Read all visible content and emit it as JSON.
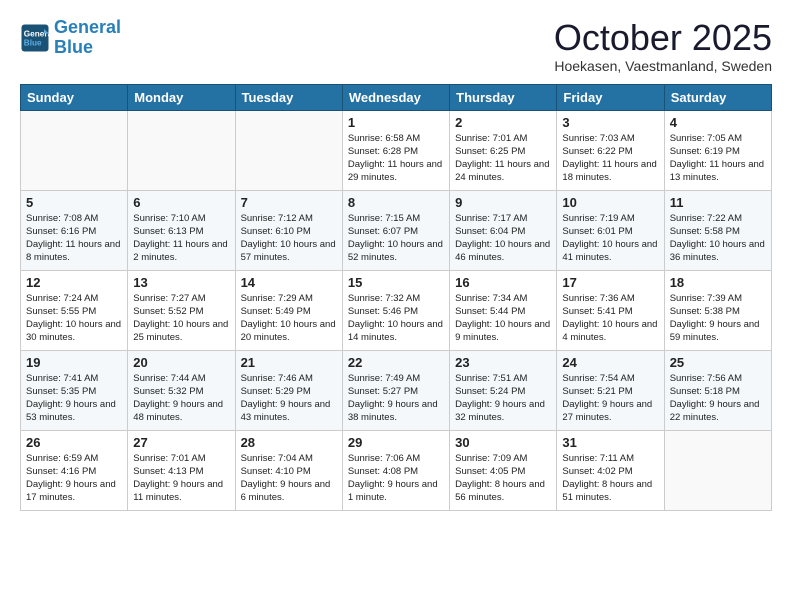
{
  "header": {
    "logo_line1": "General",
    "logo_line2": "Blue",
    "month": "October 2025",
    "location": "Hoekasen, Vaestmanland, Sweden"
  },
  "days_of_week": [
    "Sunday",
    "Monday",
    "Tuesday",
    "Wednesday",
    "Thursday",
    "Friday",
    "Saturday"
  ],
  "weeks": [
    [
      {
        "day": "",
        "info": ""
      },
      {
        "day": "",
        "info": ""
      },
      {
        "day": "",
        "info": ""
      },
      {
        "day": "1",
        "info": "Sunrise: 6:58 AM\nSunset: 6:28 PM\nDaylight: 11 hours\nand 29 minutes."
      },
      {
        "day": "2",
        "info": "Sunrise: 7:01 AM\nSunset: 6:25 PM\nDaylight: 11 hours\nand 24 minutes."
      },
      {
        "day": "3",
        "info": "Sunrise: 7:03 AM\nSunset: 6:22 PM\nDaylight: 11 hours\nand 18 minutes."
      },
      {
        "day": "4",
        "info": "Sunrise: 7:05 AM\nSunset: 6:19 PM\nDaylight: 11 hours\nand 13 minutes."
      }
    ],
    [
      {
        "day": "5",
        "info": "Sunrise: 7:08 AM\nSunset: 6:16 PM\nDaylight: 11 hours\nand 8 minutes."
      },
      {
        "day": "6",
        "info": "Sunrise: 7:10 AM\nSunset: 6:13 PM\nDaylight: 11 hours\nand 2 minutes."
      },
      {
        "day": "7",
        "info": "Sunrise: 7:12 AM\nSunset: 6:10 PM\nDaylight: 10 hours\nand 57 minutes."
      },
      {
        "day": "8",
        "info": "Sunrise: 7:15 AM\nSunset: 6:07 PM\nDaylight: 10 hours\nand 52 minutes."
      },
      {
        "day": "9",
        "info": "Sunrise: 7:17 AM\nSunset: 6:04 PM\nDaylight: 10 hours\nand 46 minutes."
      },
      {
        "day": "10",
        "info": "Sunrise: 7:19 AM\nSunset: 6:01 PM\nDaylight: 10 hours\nand 41 minutes."
      },
      {
        "day": "11",
        "info": "Sunrise: 7:22 AM\nSunset: 5:58 PM\nDaylight: 10 hours\nand 36 minutes."
      }
    ],
    [
      {
        "day": "12",
        "info": "Sunrise: 7:24 AM\nSunset: 5:55 PM\nDaylight: 10 hours\nand 30 minutes."
      },
      {
        "day": "13",
        "info": "Sunrise: 7:27 AM\nSunset: 5:52 PM\nDaylight: 10 hours\nand 25 minutes."
      },
      {
        "day": "14",
        "info": "Sunrise: 7:29 AM\nSunset: 5:49 PM\nDaylight: 10 hours\nand 20 minutes."
      },
      {
        "day": "15",
        "info": "Sunrise: 7:32 AM\nSunset: 5:46 PM\nDaylight: 10 hours\nand 14 minutes."
      },
      {
        "day": "16",
        "info": "Sunrise: 7:34 AM\nSunset: 5:44 PM\nDaylight: 10 hours\nand 9 minutes."
      },
      {
        "day": "17",
        "info": "Sunrise: 7:36 AM\nSunset: 5:41 PM\nDaylight: 10 hours\nand 4 minutes."
      },
      {
        "day": "18",
        "info": "Sunrise: 7:39 AM\nSunset: 5:38 PM\nDaylight: 9 hours\nand 59 minutes."
      }
    ],
    [
      {
        "day": "19",
        "info": "Sunrise: 7:41 AM\nSunset: 5:35 PM\nDaylight: 9 hours\nand 53 minutes."
      },
      {
        "day": "20",
        "info": "Sunrise: 7:44 AM\nSunset: 5:32 PM\nDaylight: 9 hours\nand 48 minutes."
      },
      {
        "day": "21",
        "info": "Sunrise: 7:46 AM\nSunset: 5:29 PM\nDaylight: 9 hours\nand 43 minutes."
      },
      {
        "day": "22",
        "info": "Sunrise: 7:49 AM\nSunset: 5:27 PM\nDaylight: 9 hours\nand 38 minutes."
      },
      {
        "day": "23",
        "info": "Sunrise: 7:51 AM\nSunset: 5:24 PM\nDaylight: 9 hours\nand 32 minutes."
      },
      {
        "day": "24",
        "info": "Sunrise: 7:54 AM\nSunset: 5:21 PM\nDaylight: 9 hours\nand 27 minutes."
      },
      {
        "day": "25",
        "info": "Sunrise: 7:56 AM\nSunset: 5:18 PM\nDaylight: 9 hours\nand 22 minutes."
      }
    ],
    [
      {
        "day": "26",
        "info": "Sunrise: 6:59 AM\nSunset: 4:16 PM\nDaylight: 9 hours\nand 17 minutes."
      },
      {
        "day": "27",
        "info": "Sunrise: 7:01 AM\nSunset: 4:13 PM\nDaylight: 9 hours\nand 11 minutes."
      },
      {
        "day": "28",
        "info": "Sunrise: 7:04 AM\nSunset: 4:10 PM\nDaylight: 9 hours\nand 6 minutes."
      },
      {
        "day": "29",
        "info": "Sunrise: 7:06 AM\nSunset: 4:08 PM\nDaylight: 9 hours\nand 1 minute."
      },
      {
        "day": "30",
        "info": "Sunrise: 7:09 AM\nSunset: 4:05 PM\nDaylight: 8 hours\nand 56 minutes."
      },
      {
        "day": "31",
        "info": "Sunrise: 7:11 AM\nSunset: 4:02 PM\nDaylight: 8 hours\nand 51 minutes."
      },
      {
        "day": "",
        "info": ""
      }
    ]
  ]
}
